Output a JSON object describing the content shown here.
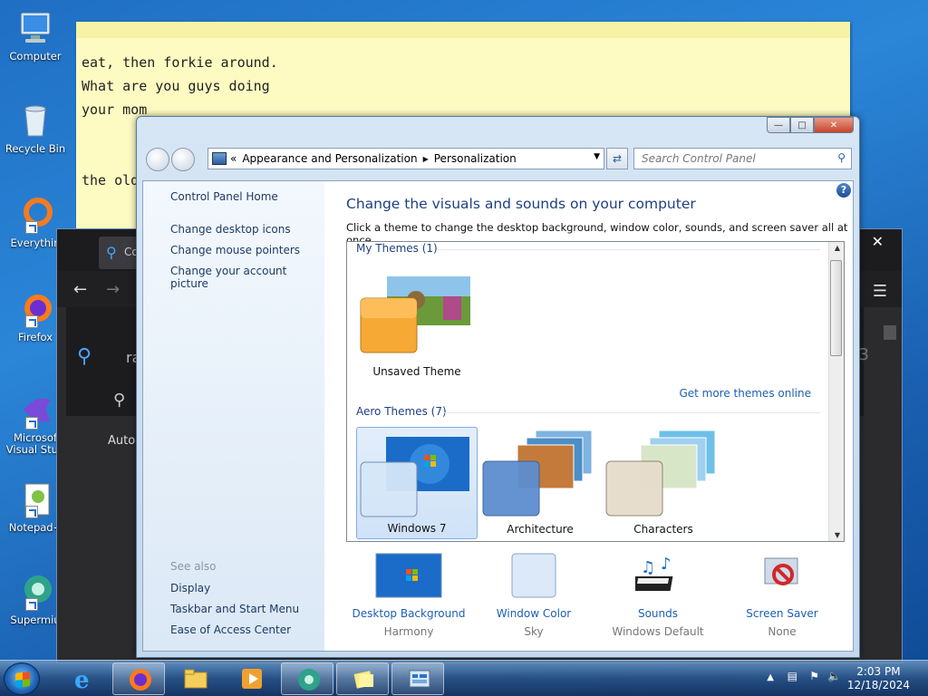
{
  "desktop": {
    "icons": [
      {
        "label": "Computer"
      },
      {
        "label": "Recycle Bin"
      },
      {
        "label": "Everythin"
      },
      {
        "label": "Firefox"
      },
      {
        "label": "Microsof\nVisual Stud"
      },
      {
        "label": "Notepad+"
      },
      {
        "label": "Supermiu"
      }
    ]
  },
  "sticky_note": {
    "lines": [
      "eat, then forkie around.",
      "What are you guys doing",
      "your mom",
      "",
      "the old"
    ]
  },
  "browser_bg": {
    "search_text": "ra",
    "tab_text": "Co",
    "autocomplete": "Auto-",
    "number_fragment": "3"
  },
  "control_panel": {
    "breadcrumb_prefix": "«",
    "breadcrumb": [
      "Appearance and Personalization",
      "Personalization"
    ],
    "search_placeholder": "Search Control Panel",
    "sidebar": {
      "home": "Control Panel Home",
      "links": [
        "Change desktop icons",
        "Change mouse pointers",
        "Change your account picture"
      ],
      "see_also": "See also",
      "see_also_links": [
        "Display",
        "Taskbar and Start Menu",
        "Ease of Access Center"
      ]
    },
    "title": "Change the visuals and sounds on your computer",
    "subtitle": "Click a theme to change the desktop background, window color, sounds, and screen saver all at once.",
    "groups": {
      "my_themes": "My Themes (1)",
      "aero_themes": "Aero Themes (7)"
    },
    "my_themes": [
      {
        "name": "Unsaved Theme"
      }
    ],
    "get_more": "Get more themes online",
    "aero_themes": [
      {
        "name": "Windows 7",
        "selected": true
      },
      {
        "name": "Architecture",
        "selected": false
      },
      {
        "name": "Characters",
        "selected": false
      }
    ],
    "bottom": [
      {
        "label": "Desktop Background",
        "value": "Harmony"
      },
      {
        "label": "Window Color",
        "value": "Sky"
      },
      {
        "label": "Sounds",
        "value": "Windows Default"
      },
      {
        "label": "Screen Saver",
        "value": "None"
      }
    ]
  },
  "taskbar": {
    "time": "2:03 PM",
    "date": "12/18/2024"
  }
}
